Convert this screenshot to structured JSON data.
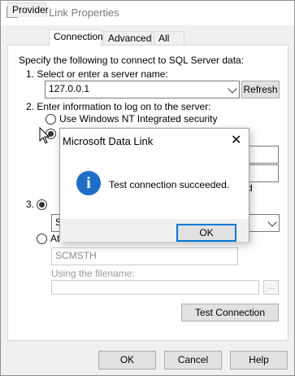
{
  "window": {
    "title": "Data Link Properties"
  },
  "tabs": [
    {
      "label": "Provider"
    },
    {
      "label": "Connection"
    },
    {
      "label": "Advanced"
    },
    {
      "label": "All"
    }
  ],
  "connection": {
    "intro": "Specify the following to connect to SQL Server data:",
    "step1_label": "1. Select or enter a server name:",
    "server_name": "127.0.0.1",
    "refresh_label": "Refresh",
    "step2_label": "2. Enter information to log on to the server:",
    "nt_security_label": "Use Windows NT Integrated security",
    "step3_prefix": "3.",
    "database_value_partial": "S",
    "attach_db_label_partial": "Att",
    "attach_db_value": "SCMSTH",
    "filename_label": "Using the filename:",
    "browse_label": "...",
    "partial_char": "d",
    "test_button": "Test Connection"
  },
  "dialog": {
    "title": "Microsoft Data Link",
    "message": "Test connection succeeded.",
    "ok_label": "OK",
    "close_glyph": "✕"
  },
  "footer": {
    "ok_label": "OK",
    "cancel_label": "Cancel",
    "help_label": "Help"
  },
  "colors": {
    "accent": "#0078d7",
    "info_icon": "#1e6ec8"
  }
}
